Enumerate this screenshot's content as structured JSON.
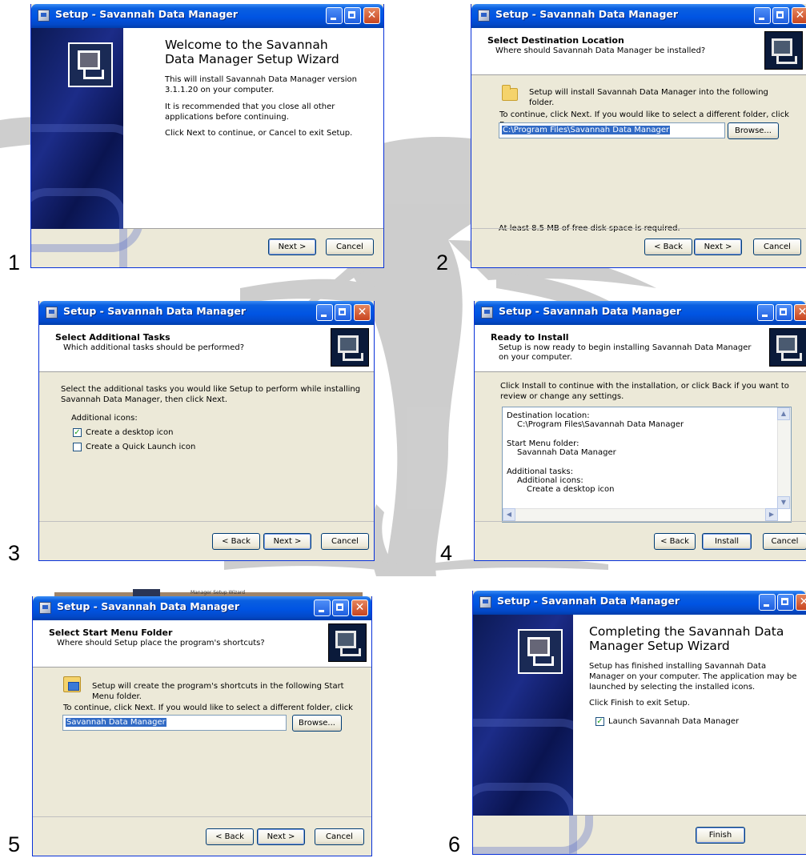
{
  "page": {
    "step_numbers": [
      "1",
      "2",
      "3",
      "4",
      "5",
      "6"
    ]
  },
  "window": {
    "title": "Setup - Savannah Data Manager"
  },
  "buttons": {
    "next": "Next >",
    "back": "< Back",
    "cancel": "Cancel",
    "browse": "Browse...",
    "install": "Install",
    "finish": "Finish"
  },
  "step1": {
    "heading": "Welcome to the Savannah Data Manager Setup Wizard",
    "para1": "This will install Savannah Data Manager version 3.1.1.20 on your computer.",
    "para2": "It is recommended that you close all other applications before continuing.",
    "para3": "Click Next to continue, or Cancel to exit Setup."
  },
  "step2": {
    "header_title": "Select Destination Location",
    "header_sub": "Where should Savannah Data Manager be installed?",
    "intro": "Setup will install Savannah Data Manager into the following folder.",
    "instruction": "To continue, click Next. If you would like to select a different folder, click Browse.",
    "path_value": "C:\\Program Files\\Savannah Data Manager",
    "disk_space": "At least 8.5 MB of free disk space is required."
  },
  "step3": {
    "header_title": "Select Additional Tasks",
    "header_sub": "Which additional tasks should be performed?",
    "instruction": "Select the additional tasks you would like Setup to perform while installing Savannah Data Manager, then click Next.",
    "group_label": "Additional icons:",
    "task1": "Create a desktop icon",
    "task1_checked": true,
    "task2": "Create a Quick Launch icon",
    "task2_checked": false
  },
  "step4": {
    "header_title": "Ready to Install",
    "header_sub": "Setup is now ready to begin installing Savannah Data Manager on your computer.",
    "instruction": "Click Install to continue with the installation, or click Back if you want to review or change any settings.",
    "memo_lines": [
      "Destination location:",
      "C:\\Program Files\\Savannah Data Manager",
      "Start Menu folder:",
      "Savannah Data Manager",
      "Additional tasks:",
      "Additional icons:",
      "Create a desktop icon"
    ]
  },
  "step5": {
    "header_title": "Select Start Menu Folder",
    "header_sub": "Where should Setup place the program's shortcuts?",
    "intro": "Setup will create the program's shortcuts in the following Start Menu folder.",
    "instruction": "To continue, click Next. If you would like to select a different folder, click Browse.",
    "folder_value": "Savannah Data Manager",
    "behind_text": "Manager Setup Wizard"
  },
  "step6": {
    "heading": "Completing the Savannah Data Manager Setup Wizard",
    "para1": "Setup has finished installing Savannah Data Manager on your computer. The application may be launched by selecting the installed icons.",
    "para2": "Click Finish to exit Setup.",
    "launch_label": "Launch Savannah Data Manager",
    "launch_checked": true
  },
  "colors": {
    "titlebar": "#0054e3",
    "dialog_face": "#ece9d8",
    "selection": "#316ac5",
    "sidebar": "#1c2c88"
  }
}
